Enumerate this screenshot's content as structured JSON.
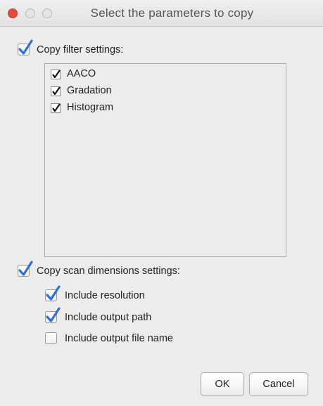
{
  "window": {
    "title": "Select the parameters to copy"
  },
  "filter_section": {
    "label": "Copy filter settings:",
    "checked": true,
    "items": [
      {
        "label": "AACO",
        "checked": true
      },
      {
        "label": "Gradation",
        "checked": true
      },
      {
        "label": "Histogram",
        "checked": true
      }
    ]
  },
  "scan_section": {
    "label": "Copy scan dimensions settings:",
    "checked": true,
    "options": [
      {
        "label": "Include resolution",
        "checked": true
      },
      {
        "label": "Include output path",
        "checked": true
      },
      {
        "label": "Include output file name",
        "checked": false
      }
    ]
  },
  "buttons": {
    "ok": "OK",
    "cancel": "Cancel"
  },
  "colors": {
    "check_blue": "#2f6fd6",
    "close_red": "#e24b3c"
  }
}
